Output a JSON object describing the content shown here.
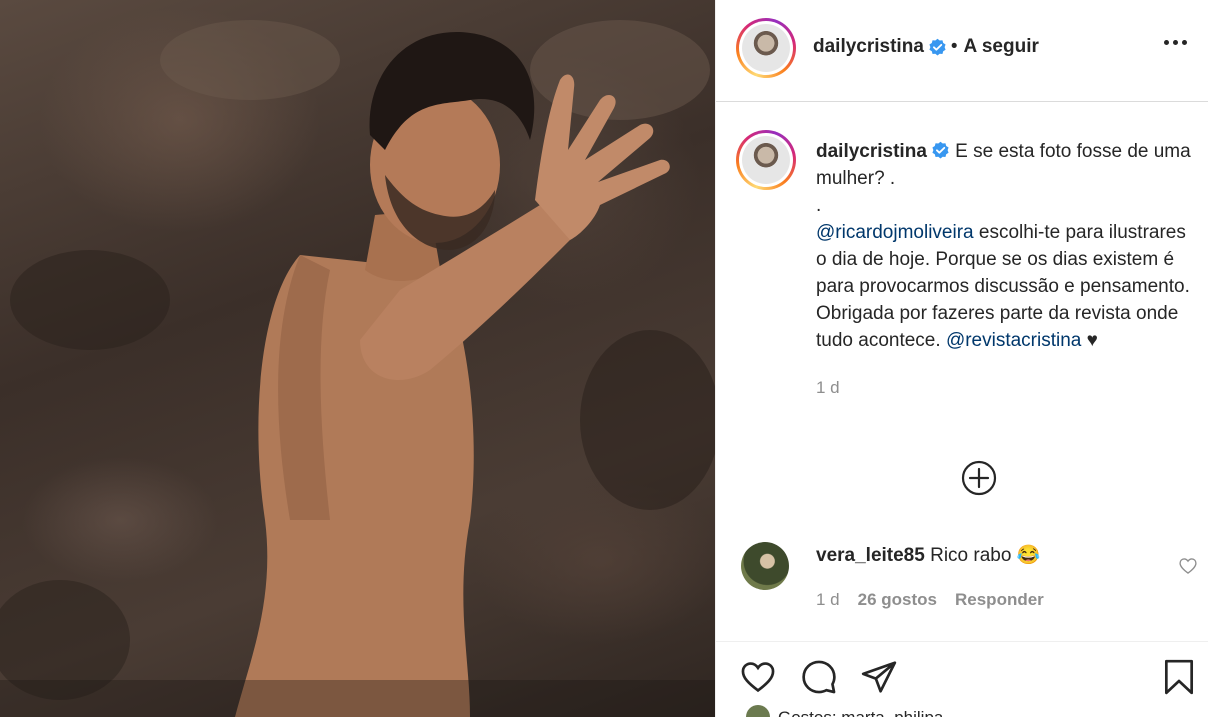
{
  "post": {
    "username": "dailycristina",
    "follow_label": "A seguir",
    "separator": "•"
  },
  "caption": {
    "username": "dailycristina",
    "line1": "E se esta foto fosse de uma mulher? .",
    "line2": ".",
    "mention1": "@ricardojmoliveira",
    "text": " escolhi-te para ilustrares o dia de hoje. Porque se os dias existem é para provocarmos discussão e pensamento. Obrigada por fazeres parte da revista onde tudo acontece.",
    "mention2": "@revistacristina",
    "heart": "♥",
    "time": "1 d"
  },
  "comment": {
    "username": "vera_leite85",
    "text": "Rico rabo",
    "emoji": "😂",
    "time": "1 d",
    "likes": "26 gostos",
    "reply_label": "Responder"
  },
  "likers": {
    "text": "Gostos: marta_philipa"
  },
  "icons": {
    "verified": "verified-badge-icon",
    "more": "more-options-icon",
    "load_more": "plus-circle-icon",
    "like": "heart-icon",
    "comment": "comment-icon",
    "share": "send-icon",
    "save": "bookmark-icon"
  },
  "colors": {
    "verified_blue": "#3897f0",
    "link": "#00376b",
    "muted": "#8e8e8e",
    "text": "#262626"
  }
}
